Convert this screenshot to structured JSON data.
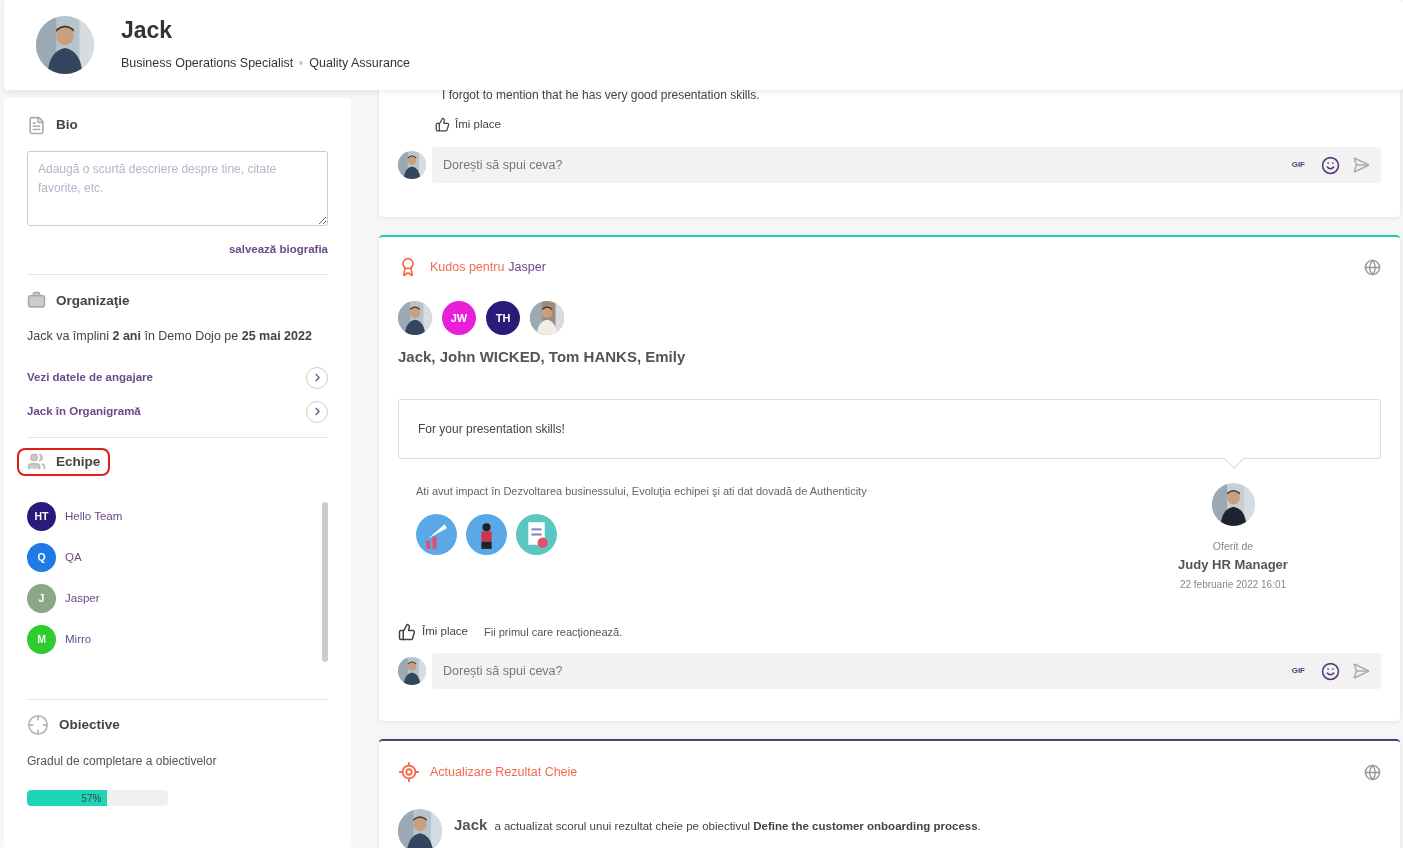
{
  "header": {
    "name": "Jack",
    "role": "Business Operations Specialist",
    "department": "Quality Assurance"
  },
  "bio": {
    "title": "Bio",
    "placeholder": "Adaugă o scurtă descriere despre tine, citate favorite, etc.",
    "save_link": "salvează biografia"
  },
  "organization": {
    "title": "Organizaţie",
    "text": "Jack va împlini **2 ani** în Demo Dojo pe **25 mai 2022**",
    "links": [
      "Vezi datele de angajare",
      "Jack în Organigramă"
    ]
  },
  "teams": {
    "title": "Echipe",
    "highlighted": true,
    "items": [
      {
        "initials": "HT",
        "name": "Hello Team",
        "color": "#2a1a7a"
      },
      {
        "initials": "Q",
        "name": "QA",
        "color": "#1e7be6"
      },
      {
        "initials": "J",
        "name": "Jasper",
        "color": "#8aa886"
      },
      {
        "initials": "M",
        "name": "Mirro",
        "color": "#2ecc2e"
      }
    ]
  },
  "objectives": {
    "title": "Obiective",
    "subtitle": "Gradul de completare a obiectivelor",
    "progress": {
      "level": 0.57,
      "label": "57%"
    }
  },
  "feed": [
    {
      "kind": "comment",
      "text": "I forgot to mention that he has very good presentation skills.",
      "like_label": "Îmi place",
      "comment_placeholder": "Dorești să spui ceva?",
      "gif_label": "GIF"
    },
    {
      "kind": "kudos",
      "title": "Kudos pentru",
      "recipient_team": "Jasper",
      "recipients": [
        {
          "kind": "picture"
        },
        {
          "kind": "initials",
          "initials": "JW",
          "color": "#e91ed9"
        },
        {
          "kind": "initials",
          "initials": "TH",
          "color": "#2a1a7a"
        },
        {
          "kind": "picture"
        }
      ],
      "names": "Jack, John WICKED, Tom HANKS, Emily",
      "message": "For your presentation skills!",
      "impact": "Ati avut impact în Dezvoltarea businessului, Evoluţia echipei şi ati dat dovadă de Authenticity",
      "given_by_label": "Oferit de",
      "giver": "Judy HR Manager",
      "date": "22 februarie 2022 16:01",
      "like_label": "Îmi place",
      "reaction_hint": "Fii primul care reacționează.",
      "comment_placeholder": "Dorești să spui ceva?",
      "gif_label": "GIF"
    },
    {
      "kind": "key_result",
      "title": "Actualizare Rezultat Cheie",
      "author": "Jack",
      "text": "a actualizat scorul unui rezultat cheie pe obiectivul **Define the customer onboarding process**."
    }
  ]
}
